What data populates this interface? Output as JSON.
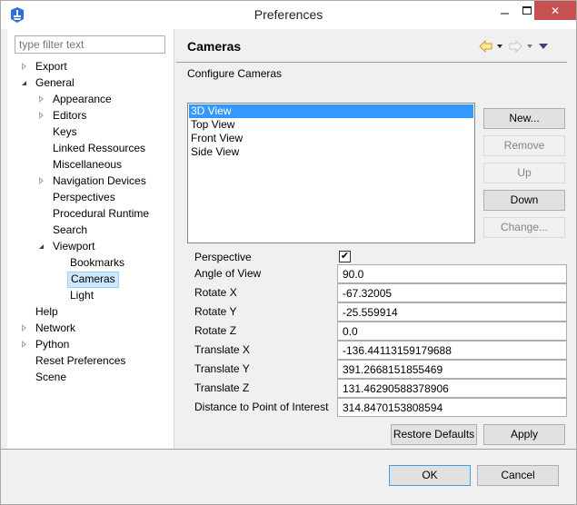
{
  "window": {
    "title": "Preferences",
    "close_glyph": "✕"
  },
  "sidebar": {
    "filter_placeholder": "type filter text",
    "items": [
      {
        "label": "Export",
        "level": 0,
        "twisty": "closed"
      },
      {
        "label": "General",
        "level": 0,
        "twisty": "open"
      },
      {
        "label": "Appearance",
        "level": 1,
        "twisty": "closed"
      },
      {
        "label": "Editors",
        "level": 1,
        "twisty": "closed"
      },
      {
        "label": "Keys",
        "level": 1,
        "twisty": "none"
      },
      {
        "label": "Linked Ressources",
        "level": 1,
        "twisty": "none"
      },
      {
        "label": "Miscellaneous",
        "level": 1,
        "twisty": "none"
      },
      {
        "label": "Navigation Devices",
        "level": 1,
        "twisty": "closed"
      },
      {
        "label": "Perspectives",
        "level": 1,
        "twisty": "none"
      },
      {
        "label": "Procedural Runtime",
        "level": 1,
        "twisty": "none"
      },
      {
        "label": "Search",
        "level": 1,
        "twisty": "none"
      },
      {
        "label": "Viewport",
        "level": 1,
        "twisty": "open"
      },
      {
        "label": "Bookmarks",
        "level": 2,
        "twisty": "none"
      },
      {
        "label": "Cameras",
        "level": 2,
        "twisty": "none",
        "selected": true
      },
      {
        "label": "Light",
        "level": 2,
        "twisty": "none"
      },
      {
        "label": "Help",
        "level": 0,
        "twisty": "none"
      },
      {
        "label": "Network",
        "level": 0,
        "twisty": "closed"
      },
      {
        "label": "Python",
        "level": 0,
        "twisty": "closed"
      },
      {
        "label": "Reset Preferences",
        "level": 0,
        "twisty": "none"
      },
      {
        "label": "Scene",
        "level": 0,
        "twisty": "none"
      }
    ]
  },
  "page": {
    "title": "Cameras",
    "description": "Configure Cameras",
    "nav": {
      "back_color": "#f0c040",
      "forward_color": "#d8d8d8",
      "menu_color": "#404070"
    },
    "cameras": [
      "3D View",
      "Top View",
      "Front View",
      "Side View"
    ],
    "selected_camera": "3D View",
    "buttons": {
      "new": "New...",
      "remove": "Remove",
      "up": "Up",
      "down": "Down",
      "change": "Change..."
    },
    "fields": {
      "perspective": {
        "label": "Perspective",
        "checked": true,
        "glyph": "✔"
      },
      "angle_of_view": {
        "label": "Angle of View",
        "value": "90.0"
      },
      "rotate_x": {
        "label": "Rotate X",
        "value": "-67.32005"
      },
      "rotate_y": {
        "label": "Rotate Y",
        "value": "-25.559914"
      },
      "rotate_z": {
        "label": "Rotate Z",
        "value": "0.0"
      },
      "translate_x": {
        "label": "Translate X",
        "value": "-136.44113159179688"
      },
      "translate_y": {
        "label": "Translate Y",
        "value": "391.2668151855469"
      },
      "translate_z": {
        "label": "Translate Z",
        "value": "131.46290588378906"
      },
      "distance_poi": {
        "label": "Distance to Point of Interest",
        "value": "314.8470153808594"
      }
    },
    "restore_defaults": "Restore Defaults",
    "apply": "Apply"
  },
  "footer": {
    "ok": "OK",
    "cancel": "Cancel"
  }
}
